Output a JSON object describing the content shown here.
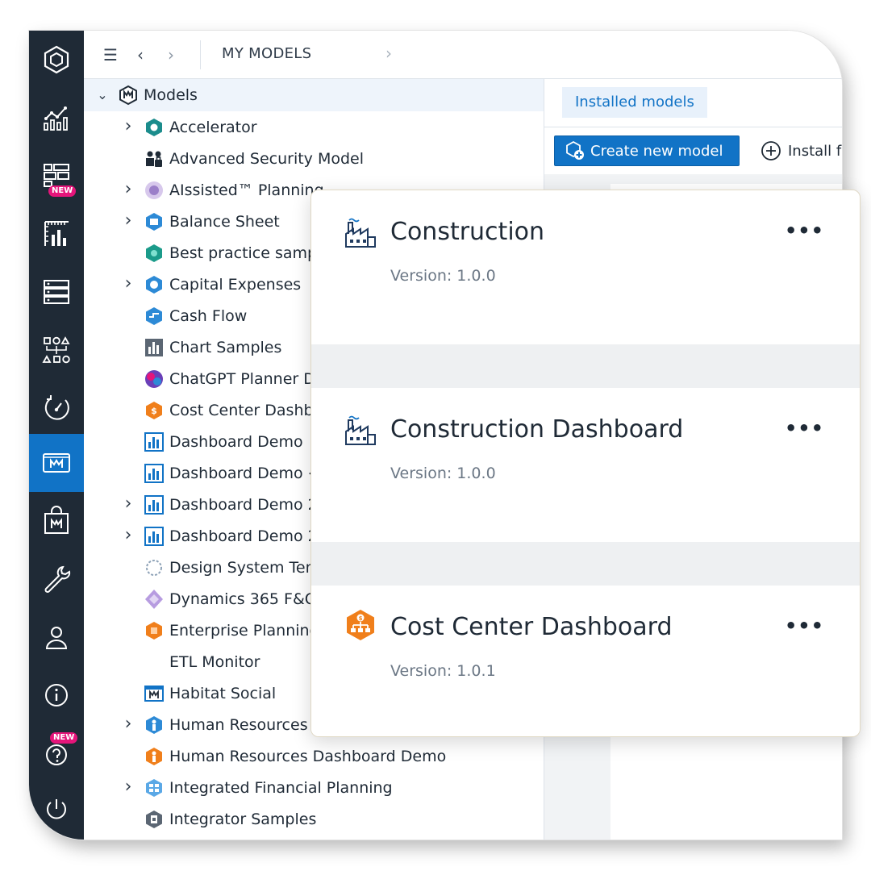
{
  "rail": {
    "items": [
      {
        "icon": "hexagon-logo-icon"
      },
      {
        "icon": "analytics-icon"
      },
      {
        "icon": "dashboards-icon",
        "badge": "NEW"
      },
      {
        "icon": "reports-icon"
      },
      {
        "icon": "data-sources-icon"
      },
      {
        "icon": "workflow-icon"
      },
      {
        "icon": "monitor-icon"
      },
      {
        "icon": "models-icon",
        "active": true
      },
      {
        "icon": "marketplace-icon"
      },
      {
        "icon": "tools-icon"
      },
      {
        "icon": "user-icon"
      },
      {
        "icon": "info-icon"
      },
      {
        "icon": "help-icon",
        "badge": "NEW"
      },
      {
        "icon": "power-icon"
      }
    ]
  },
  "toolbar": {
    "breadcrumb": "MY MODELS"
  },
  "tree": {
    "root": "Models",
    "items": [
      {
        "label": "Accelerator",
        "expandable": true,
        "icon": "accelerator-icon"
      },
      {
        "label": "Advanced Security Model",
        "expandable": false,
        "icon": "security-model-icon"
      },
      {
        "label": "AIssisted™ Planning",
        "expandable": true,
        "icon": "ai-planning-icon"
      },
      {
        "label": "Balance Sheet",
        "expandable": true,
        "icon": "balance-sheet-icon"
      },
      {
        "label": "Best practice samp",
        "expandable": false,
        "icon": "best-practice-icon"
      },
      {
        "label": "Capital Expenses",
        "expandable": true,
        "icon": "capital-expenses-icon"
      },
      {
        "label": "Cash Flow",
        "expandable": false,
        "icon": "cash-flow-icon"
      },
      {
        "label": "Chart Samples",
        "expandable": false,
        "icon": "chart-samples-icon"
      },
      {
        "label": "ChatGPT Planner D",
        "expandable": false,
        "icon": "chatgpt-icon"
      },
      {
        "label": "Cost Center Dashbo",
        "expandable": false,
        "icon": "cost-center-icon"
      },
      {
        "label": "Dashboard Demo",
        "expandable": false,
        "icon": "dashboard-icon"
      },
      {
        "label": "Dashboard Demo <",
        "expandable": false,
        "icon": "dashboard-icon"
      },
      {
        "label": "Dashboard Demo 2",
        "expandable": true,
        "icon": "dashboard-icon"
      },
      {
        "label": "Dashboard Demo 2",
        "expandable": true,
        "icon": "dashboard-icon"
      },
      {
        "label": "Design System Tem",
        "expandable": false,
        "icon": "design-system-icon"
      },
      {
        "label": "Dynamics 365 F&O",
        "expandable": false,
        "icon": "dynamics-icon"
      },
      {
        "label": "Enterprise Planning",
        "expandable": false,
        "icon": "enterprise-icon"
      },
      {
        "label": "ETL Monitor",
        "expandable": false,
        "icon": ""
      },
      {
        "label": "Habitat Social",
        "expandable": false,
        "icon": "habitat-icon"
      },
      {
        "label": "Human Resources",
        "expandable": true,
        "icon": "hr-icon"
      },
      {
        "label": "Human Resources Dashboard Demo",
        "expandable": false,
        "icon": "hr-dashboard-icon"
      },
      {
        "label": "Integrated Financial Planning",
        "expandable": true,
        "icon": "ifp-icon"
      },
      {
        "label": "Integrator Samples",
        "expandable": false,
        "icon": "integrator-icon"
      }
    ]
  },
  "panel": {
    "tab_installed": "Installed models",
    "create_button": "Create new model",
    "install_button": "Install f"
  },
  "popup": {
    "cards": [
      {
        "title": "Construction",
        "version": "Version: 1.0.0",
        "icon": "factory-icon"
      },
      {
        "title": "Construction Dashboard",
        "version": "Version: 1.0.0",
        "icon": "factory-icon"
      },
      {
        "title": "Cost Center Dashboard",
        "version": "Version: 1.0.1",
        "icon": "cost-center-icon"
      }
    ],
    "menu_label": "•••"
  },
  "colors": {
    "rail_bg": "#1f2a36",
    "accent": "#1173c6",
    "badge": "#e5157a",
    "orange": "#f07f1b"
  }
}
